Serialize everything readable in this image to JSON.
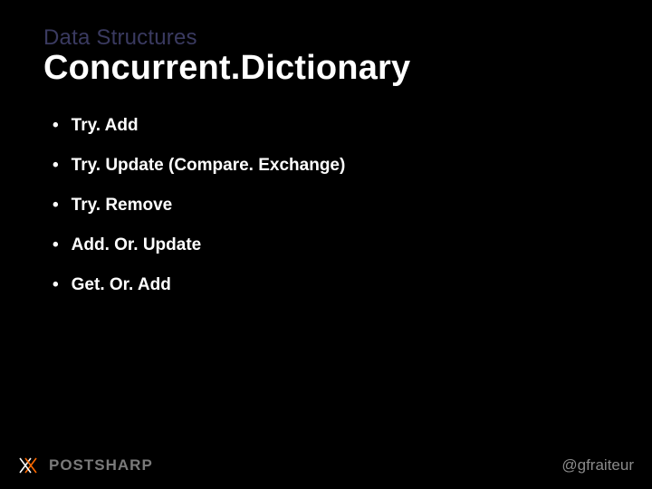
{
  "eyebrow": "Data Structures",
  "title": "Concurrent.Dictionary",
  "bullets": [
    "Try. Add",
    "Try. Update (Compare. Exchange)",
    "Try. Remove",
    "Add. Or. Update",
    "Get. Or. Add"
  ],
  "logo_text": "POSTSHARP",
  "handle": "@gfraiteur"
}
